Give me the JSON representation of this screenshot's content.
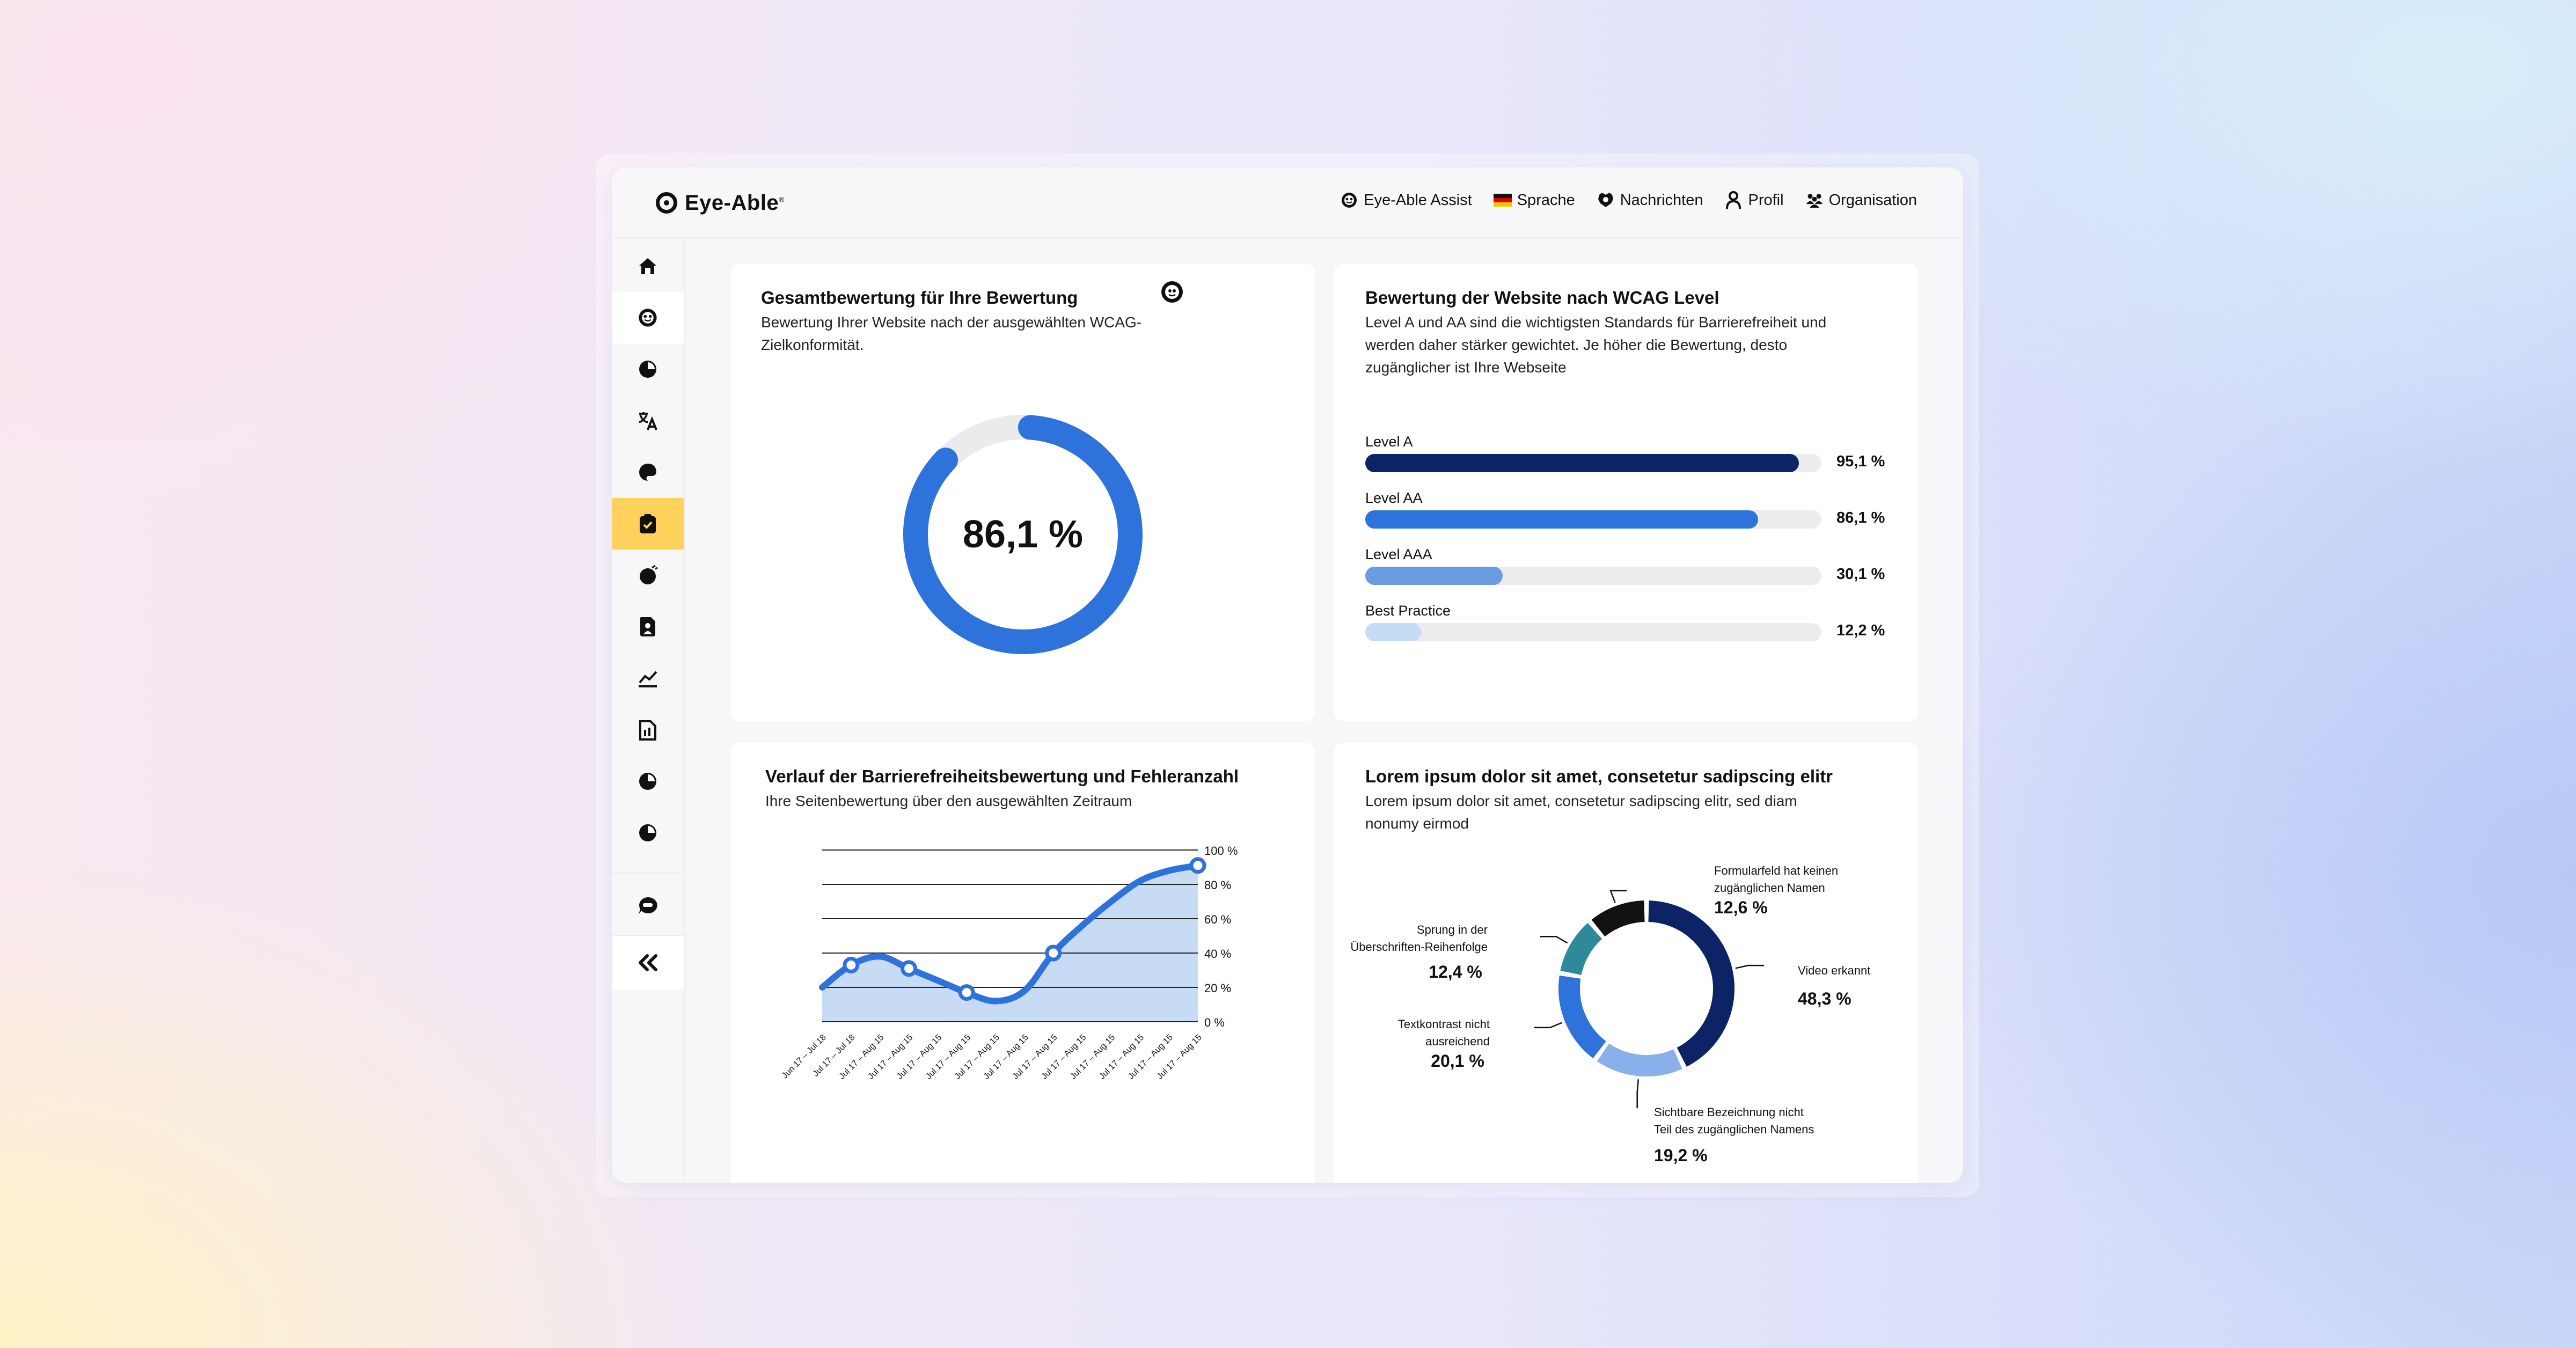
{
  "app": {
    "brand": "Eye-Able",
    "brand_mark": "®"
  },
  "topnav": [
    {
      "label": "Eye-Able Assist",
      "icon": "assist-icon"
    },
    {
      "label": "Sprache",
      "icon": "german-flag-icon"
    },
    {
      "label": "Nachrichten",
      "icon": "messages-icon"
    },
    {
      "label": "Profil",
      "icon": "profile-icon"
    },
    {
      "label": "Organisation",
      "icon": "organization-icon"
    }
  ],
  "sidebar": {
    "items": [
      {
        "icon": "home-icon"
      },
      {
        "icon": "assist-icon"
      },
      {
        "icon": "pie-chart-icon"
      },
      {
        "icon": "translate-icon"
      },
      {
        "icon": "palette-icon"
      },
      {
        "icon": "clipboard-check-icon",
        "active": true
      },
      {
        "icon": "bug-icon"
      },
      {
        "icon": "document-icon"
      },
      {
        "icon": "stats-icon"
      },
      {
        "icon": "report-icon"
      },
      {
        "icon": "pie-chart-icon"
      },
      {
        "icon": "pie-chart-icon"
      }
    ],
    "bottom": [
      {
        "icon": "chat-icon"
      },
      {
        "icon": "collapse-icon"
      }
    ]
  },
  "colors": {
    "accent_yellow": "#fdd15c",
    "primary_blue": "#2e72dc",
    "dark_navy": "#0c2366",
    "mid_blue": "#6b9be0",
    "light_blue": "#c5dbf6",
    "teal": "#2e8a99",
    "black": "#111111"
  },
  "overall": {
    "title": "Gesamtbewertung für Ihre Bewertung",
    "subtitle_line1": "Bewertung Ihrer Website nach der ausgewählten WCAG-",
    "subtitle_line2": "Zielkonformität.",
    "score_text": "86,1 %",
    "score": 86.1,
    "info_icon": "info-icon"
  },
  "wcag": {
    "title": "Bewertung der Website nach WCAG Level",
    "subtitle_line1": "Level A und AA sind die wichtigsten Standards für Barrierefreiheit und",
    "subtitle_line2": "werden daher stärker gewichtet. Je höher die Bewertung, desto",
    "subtitle_line3": "zugänglicher ist Ihre Webseite",
    "levels": [
      {
        "label": "Level A",
        "value": 95.1,
        "value_text": "95,1 %",
        "color": "#0c2366"
      },
      {
        "label": "Level AA",
        "value": 86.1,
        "value_text": "86,1 %",
        "color": "#2e72dc"
      },
      {
        "label": "Level AAA",
        "value": 30.1,
        "value_text": "30,1 %",
        "color": "#6b9be0"
      },
      {
        "label": "Best Practice",
        "value": 12.2,
        "value_text": "12,2 %",
        "color": "#c5dbf6"
      }
    ]
  },
  "history": {
    "title": "Verlauf der Barrierefreiheitsbewertung und Fehleranzahl",
    "subtitle": "Ihre Seitenbewertung über den ausgewählten Zeitraum"
  },
  "distribution": {
    "title": "Lorem ipsum dolor sit amet, consetetur sadipscing elitr",
    "subtitle_line1": "Lorem ipsum dolor sit amet, consetetur sadipscing elitr, sed diam",
    "subtitle_line2": "nonumy eirmod"
  },
  "chart_data": [
    {
      "type": "area",
      "y_ticks": [
        "100 %",
        "80 %",
        "60 %",
        "40 %",
        "20 %",
        "0 %"
      ],
      "ylim": [
        0,
        100
      ],
      "grid": true,
      "categories": [
        "Jun 17 – Jul 18",
        "Jul 17 – Jul 18",
        "Jul 17 – Aug 15",
        "Jul 17 – Aug 15",
        "Jul 17 – Aug 15",
        "Jul 17 – Aug 15",
        "Jul 17 – Aug 15",
        "Jul 17 – Aug 15",
        "Jul 17 – Aug 15",
        "Jul 17 – Aug 15",
        "Jul 17 – Aug 15",
        "Jul 17 – Aug 15",
        "Jul 17 – Aug 15",
        "Jul 17 – Aug 15"
      ],
      "series": [
        {
          "x": [
            0,
            1,
            2,
            3,
            4,
            5,
            6,
            7,
            8,
            9,
            10,
            11,
            12,
            13
          ],
          "values": [
            20,
            33,
            38,
            31,
            24,
            17,
            12,
            18,
            40,
            56,
            70,
            82,
            88,
            91
          ],
          "markers": [
            1,
            3,
            5,
            8,
            13
          ]
        }
      ]
    },
    {
      "type": "pie",
      "series": [
        {
          "labels": [
            "Video erkannt",
            "Sichtbare Bezeichnung nicht Teil des zugänglichen Namens",
            "Textkontrast nicht ausreichend",
            "Sprung in der Überschriften-Reihenfolge",
            "Formularfeld hat keinen zugänglichen Namen"
          ],
          "values": [
            48.3,
            19.2,
            20.1,
            12.4,
            12.6
          ],
          "colors": [
            "#0c2366",
            "#8ab0ec",
            "#2e72dc",
            "#2e8a99",
            "#111111"
          ]
        }
      ],
      "annotations": [
        {
          "line1": "Video erkannt",
          "line2": "",
          "value_text": "48,3 %"
        },
        {
          "line1": "Sichtbare Bezeichnung nicht",
          "line2": "Teil des zugänglichen Namens",
          "value_text": "19,2 %"
        },
        {
          "line1": "Textkontrast nicht",
          "line2": "ausreichend",
          "value_text": "20,1 %"
        },
        {
          "line1": "Sprung in der",
          "line2": "Überschriften-Reihenfolge",
          "value_text": "12,4 %"
        },
        {
          "line1": "Formularfeld hat keinen",
          "line2": "zugänglichen Namen",
          "value_text": "12,6 %"
        }
      ]
    }
  ]
}
